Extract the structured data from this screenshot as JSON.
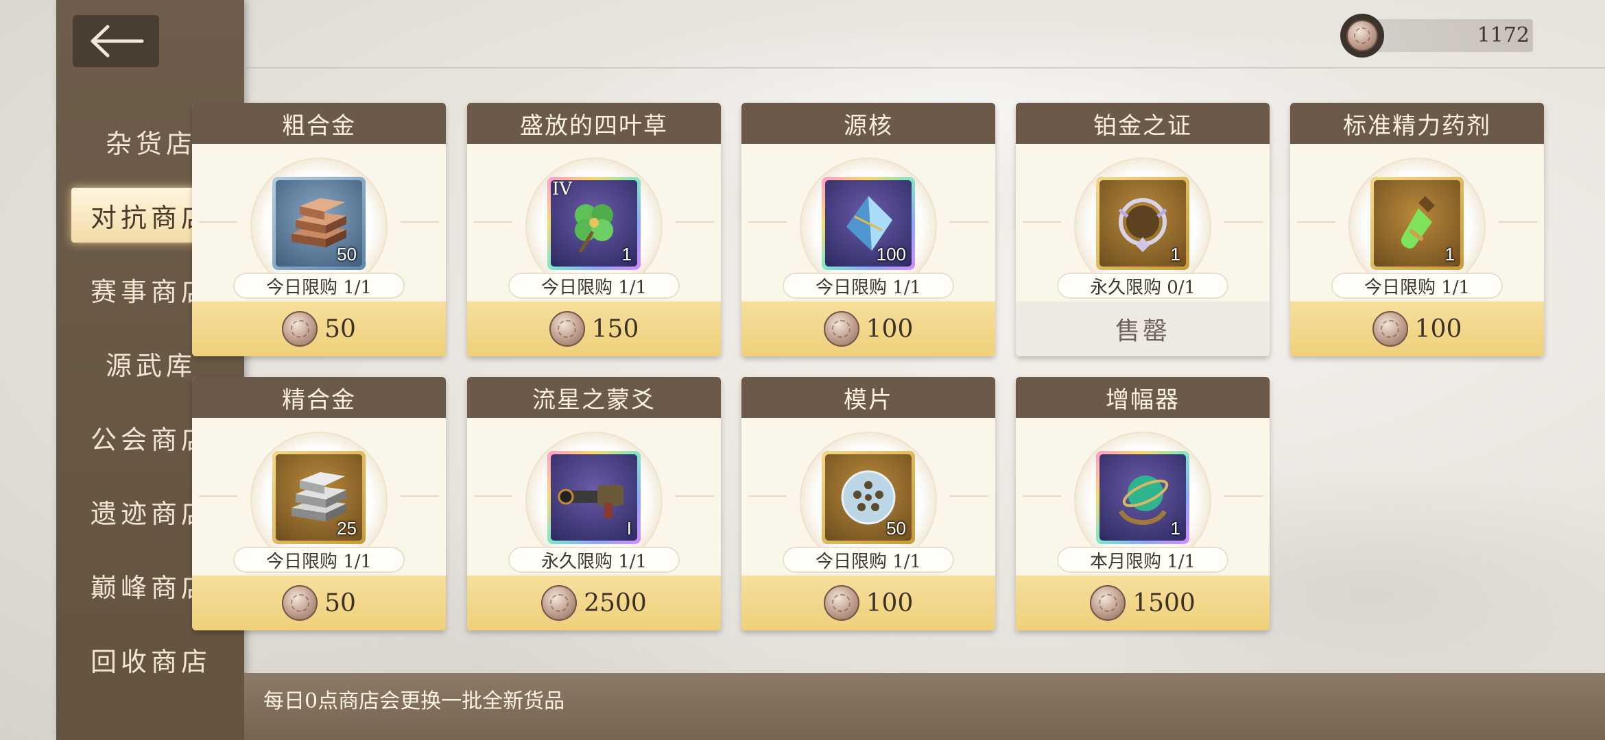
{
  "currency": {
    "icon": "coin-icon",
    "value": "1172"
  },
  "sidebar": {
    "back_icon": "back-arrow-icon",
    "items": [
      {
        "label": "杂货店",
        "active": false
      },
      {
        "label": "对抗商店",
        "active": true
      },
      {
        "label": "赛事商店",
        "active": false
      },
      {
        "label": "源武库",
        "active": false
      },
      {
        "label": "公会商店",
        "active": false
      },
      {
        "label": "遗迹商店",
        "active": false
      },
      {
        "label": "巅峰商店",
        "active": false
      },
      {
        "label": "回收商店",
        "active": false
      }
    ]
  },
  "shop": {
    "items": [
      {
        "name": "粗合金",
        "icon": "copper-ingot-icon",
        "count": "50",
        "limit": "今日限购 1/1",
        "price": "50"
      },
      {
        "name": "盛放的四叶草",
        "icon": "four-leaf-clover-icon",
        "tier": "IV",
        "count": "1",
        "limit": "今日限购 1/1",
        "price": "150"
      },
      {
        "name": "源核",
        "icon": "crystal-core-icon",
        "count": "100",
        "limit": "今日限购 1/1",
        "price": "100"
      },
      {
        "name": "铂金之证",
        "icon": "platinum-emblem-icon",
        "count": "1",
        "limit": "永久限购 0/1",
        "price": "售罄"
      },
      {
        "name": "标准精力药剂",
        "icon": "energy-potion-icon",
        "count": "1",
        "limit": "今日限购 1/1",
        "price": "100"
      },
      {
        "name": "精合金",
        "icon": "silver-ingot-icon",
        "count": "25",
        "limit": "今日限购 1/1",
        "price": "50"
      },
      {
        "name": "流星之蒙爻",
        "icon": "cannon-weapon-icon",
        "count": "I",
        "limit": "永久限购 1/1",
        "price": "2500"
      },
      {
        "name": "模片",
        "icon": "chip-disc-icon",
        "count": "50",
        "limit": "今日限购 1/1",
        "price": "100"
      },
      {
        "name": "增幅器",
        "icon": "armillary-sphere-icon",
        "count": "1",
        "limit": "本月限购 1/1",
        "price": "1500"
      }
    ]
  },
  "footer": {
    "notice": "每日0点商店会更换一批全新货品"
  }
}
